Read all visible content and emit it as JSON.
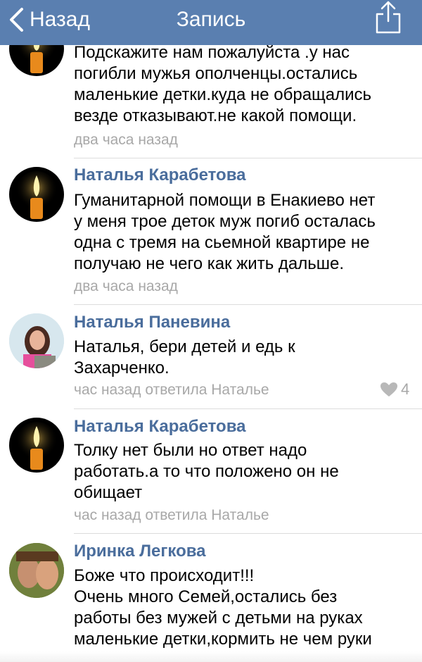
{
  "nav": {
    "back_label": "Назад",
    "title": "Запись",
    "bg_color": "#5a7fb0"
  },
  "comments": [
    {
      "author": "",
      "avatar": "candle-icon",
      "lines": [
        "Подскажите нам пожалуйста .у нас",
        "погибли мужья ополченцы.остались",
        "маленькие детки.куда не обращались",
        "везде отказывают.не какой помощи."
      ],
      "time": "два часа назад"
    },
    {
      "author": "Наталья Карабетова",
      "avatar": "candle-icon",
      "lines": [
        "Гуманитарной помощи в Енакиево нет",
        "у меня трое деток муж погиб осталась",
        "одна с тремя на сьемной квартире не",
        "получаю не чего как жить дальше."
      ],
      "time": "два часа назад"
    },
    {
      "author": "Наталья Паневина",
      "avatar": "user-photo-avatar",
      "lines": [
        "Наталья, бери детей и едь к",
        "Захарченко."
      ],
      "time": "час назад ответила Наталье",
      "likes": "4"
    },
    {
      "author": "Наталья Карабетова",
      "avatar": "candle-icon",
      "lines": [
        "Толку нет были но ответ надо",
        "работать.а то что положено он не",
        "обищает"
      ],
      "time": "час назад ответила Наталье"
    },
    {
      "author": "Иринка Легкова",
      "avatar": "user-photo-avatar",
      "lines": [
        "Боже что происходит!!!",
        "Очень много Семей,остались без",
        "работы без мужей с детьми на руках",
        "маленькие детки,кормить не чем руки"
      ]
    }
  ]
}
